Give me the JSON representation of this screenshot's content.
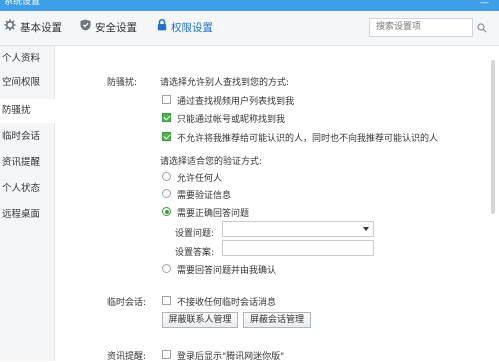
{
  "window": {
    "title": "系统设置"
  },
  "tabs": [
    {
      "label": "基本设置",
      "icon": "gear-icon"
    },
    {
      "label": "安全设置",
      "icon": "shield-icon"
    },
    {
      "label": "权限设置",
      "icon": "lock-icon"
    }
  ],
  "search": {
    "placeholder": "搜索设置项"
  },
  "sidebar": {
    "items": [
      {
        "label": "个人资料"
      },
      {
        "label": "空间权限"
      },
      {
        "label": "防骚扰"
      },
      {
        "label": "临时会话"
      },
      {
        "label": "资讯提醒"
      },
      {
        "label": "个人状态"
      },
      {
        "label": "远程桌面"
      }
    ]
  },
  "anti_harass": {
    "section_label": "防骚扰:",
    "find_prompt": "请选择允许别人查找到您的方式:",
    "find_options": [
      {
        "label": "通过查找视频用户列表找到我",
        "checked": false
      },
      {
        "label": "只能通过帐号或昵称找到我",
        "checked": true
      },
      {
        "label": "不允许将我推荐给可能认识的人，同时也不向我推荐可能认识的人",
        "checked": true
      }
    ],
    "verify_prompt": "请选择适合您的验证方式:",
    "verify_options": [
      {
        "label": "允许任何人",
        "selected": false
      },
      {
        "label": "需要验证信息",
        "selected": false
      },
      {
        "label": "需要正确回答问题",
        "selected": true
      },
      {
        "label": "需要回答问题并由我确认",
        "selected": false
      }
    ],
    "question_label": "设置问题:",
    "question_value": "",
    "answer_label": "设置答案:",
    "answer_value": ""
  },
  "temp_chat": {
    "section_label": "临时会话:",
    "option": {
      "label": "不接收任何临时会话消息",
      "checked": false
    },
    "buttons": {
      "block_contacts": "屏蔽联系人管理",
      "block_sessions": "屏蔽会话管理"
    }
  },
  "news": {
    "section_label": "资讯提醒:",
    "option": {
      "label": "登录后显示\"腾讯网迷你版\"",
      "checked": false
    }
  }
}
